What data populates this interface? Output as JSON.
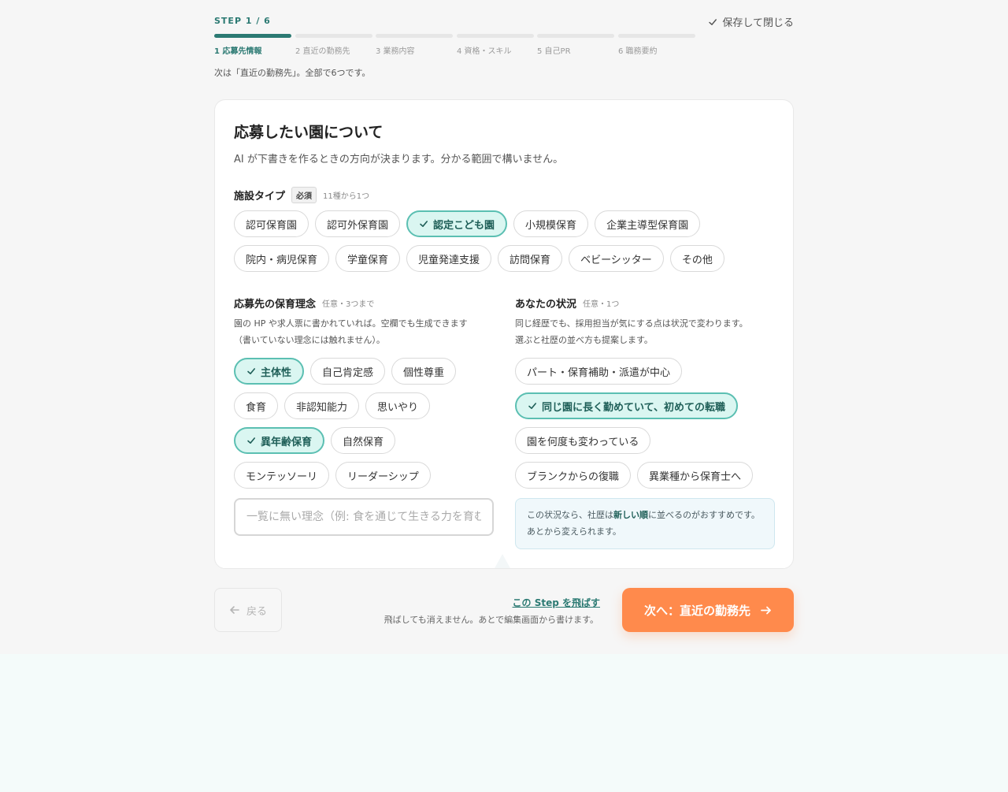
{
  "header": {
    "step_label": "STEP 1 / 6",
    "save_close": "保存して閉じる",
    "progress": {
      "current": 1,
      "total": 6
    },
    "steps": [
      "1 応募先情報",
      "2 直近の勤務先",
      "3 業務内容",
      "4 資格・スキル",
      "5 自己PR",
      "6 職務要約"
    ],
    "next_hint": "次は「直近の勤務先」。全部で6つです。"
  },
  "card": {
    "title": "応募したい園について",
    "description": "AI が下書きを作るときの方向が決まります。分かる範囲で構いません。",
    "facility": {
      "title": "施設タイプ",
      "badge": "必須",
      "note": "11種から1つ",
      "options": [
        "認可保育園",
        "認可外保育園",
        "認定こども園",
        "小規模保育",
        "企業主導型保育園",
        "院内・病児保育",
        "学童保育",
        "児童発達支援",
        "訪問保育",
        "ベビーシッター",
        "その他"
      ],
      "selected": "認定こども園"
    },
    "philosophy": {
      "title": "応募先の保育理念",
      "note": "任意・3つまで",
      "desc_line1": "園の HP や求人票に書かれていれば。空欄でも生成できます",
      "desc_line2": "（書いていない理念には触れません）。",
      "options": [
        "主体性",
        "自己肯定感",
        "個性尊重",
        "食育",
        "非認知能力",
        "思いやり",
        "異年齢保育",
        "自然保育",
        "モンテッソーリ",
        "リーダーシップ"
      ],
      "selected": [
        "主体性",
        "異年齢保育"
      ],
      "input_placeholder": "一覧に無い理念（例: 食を通じて生きる力を育む）",
      "input_value": ""
    },
    "situation": {
      "title": "あなたの状況",
      "note": "任意・1つ",
      "desc_line1": "同じ経歴でも、採用担当が気にする点は状況で変わります。",
      "desc_line2": "選ぶと社歴の並べ方も提案します。",
      "options": [
        "パート・保育補助・派遣が中心",
        "同じ園に長く勤めていて、初めての転職",
        "園を何度も変わっている",
        "ブランクからの復職",
        "異業種から保育士へ"
      ],
      "selected": "同じ園に長く勤めていて、初めての転職",
      "tip_pre": "この状況なら、社歴は",
      "tip_bold": "新しい順",
      "tip_post": "に並べるのがおすすめです。あとから変えられます。"
    }
  },
  "footer": {
    "back_label": "戻る",
    "skip_label": "この Step を飛ばす",
    "skip_note": "飛ばしても消えません。あとで編集画面から書けます。",
    "next_label": "次へ：直近の勤務先"
  },
  "colors": {
    "accent": "#2c7a73",
    "selected_bg": "#daf6f1",
    "selected_border": "#5bbfb2",
    "cta": "#ff8a4c"
  },
  "icons": {
    "check": "check-icon",
    "back": "arrow-left-icon",
    "next": "arrow-right-icon"
  }
}
